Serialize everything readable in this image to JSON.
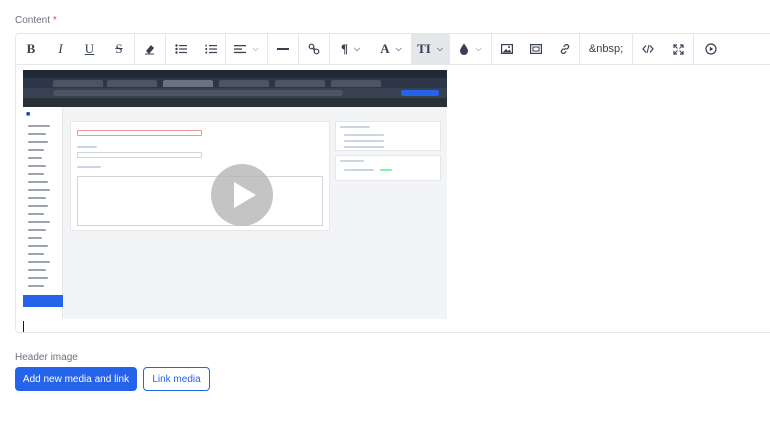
{
  "content_field": {
    "label": "Content",
    "required_mark": "*"
  },
  "toolbar": {
    "bold": "B",
    "italic": "I",
    "underline": "U",
    "strikethrough": "S",
    "paragraph": "¶",
    "font_color": "A",
    "text_size": "TI",
    "nbsp": "&nbsp;"
  },
  "video": {
    "state": "paused",
    "play_icon": "play-icon"
  },
  "header_image": {
    "label": "Header image",
    "add_button": "Add new media and link",
    "link_button": "Link media"
  },
  "colors": {
    "accent": "#2563eb",
    "required": "#ef4444",
    "border": "#e5e7eb",
    "label": "#6b7280"
  }
}
